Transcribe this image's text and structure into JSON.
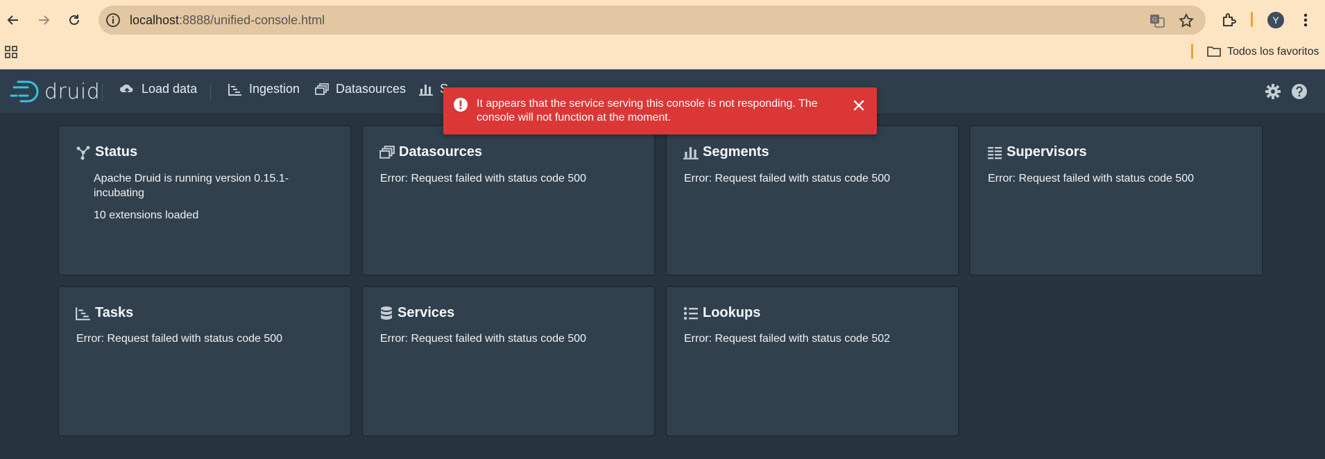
{
  "browser": {
    "url_host": "localhost",
    "url_path": ":8888/unified-console.html",
    "bookmarks_folder_label": "Todos los favoritos",
    "profile_initial": "Y"
  },
  "header": {
    "logo_text": "druid",
    "nav": [
      {
        "label": "Load data",
        "icon": "cloud-upload-icon"
      },
      {
        "label": "Ingestion",
        "icon": "gantt-chart-icon"
      },
      {
        "label": "Datasources",
        "icon": "multi-select-icon"
      },
      {
        "label": "S",
        "icon": "stacked-chart-icon"
      }
    ],
    "right_icons": [
      "cog-icon",
      "help-icon"
    ]
  },
  "toast": {
    "message": "It appears that the service serving this console is not responding. The console will not function at the moment.",
    "intent_color": "#db3737"
  },
  "cards": {
    "status": {
      "title": "Status",
      "line1": "Apache Druid is running version 0.15.1-incubating",
      "line2": "10 extensions loaded"
    },
    "datasources": {
      "title": "Datasources",
      "line1": "Error: Request failed with status code 500"
    },
    "segments": {
      "title": "Segments",
      "line1": "Error: Request failed with status code 500"
    },
    "supervisors": {
      "title": "Supervisors",
      "line1": "Error: Request failed with status code 500"
    },
    "tasks": {
      "title": "Tasks",
      "line1": "Error: Request failed with status code 500"
    },
    "services": {
      "title": "Services",
      "line1": "Error: Request failed with status code 500"
    },
    "lookups": {
      "title": "Lookups",
      "line1": "Error: Request failed with status code 502"
    }
  }
}
